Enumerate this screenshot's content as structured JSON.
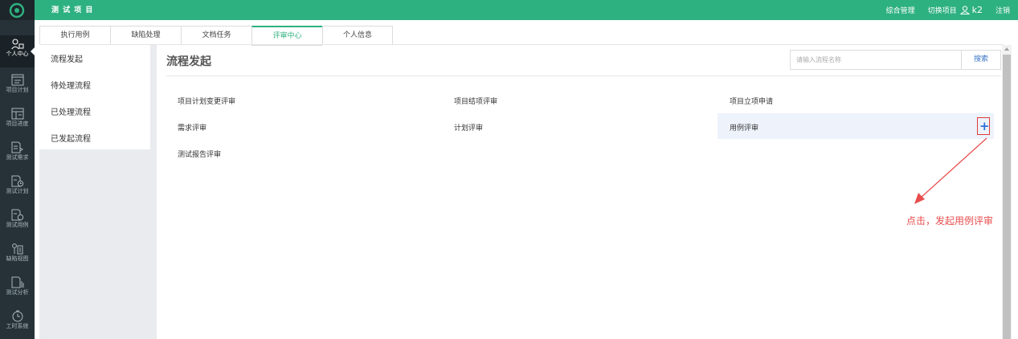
{
  "header": {
    "project_title": "测 试 项 目",
    "nav": {
      "admin": "综合管理",
      "switch_project": "切换项目",
      "username": "k2",
      "logout": "注销"
    }
  },
  "rail": {
    "items": [
      {
        "label": "个人中心",
        "icon": "person-center-icon"
      },
      {
        "label": "项目计划",
        "icon": "project-plan-icon"
      },
      {
        "label": "项目进度",
        "icon": "project-progress-icon"
      },
      {
        "label": "测试需求",
        "icon": "test-requirement-icon"
      },
      {
        "label": "测试计划",
        "icon": "test-plan-icon"
      },
      {
        "label": "测试用例",
        "icon": "test-case-icon"
      },
      {
        "label": "缺陷视图",
        "icon": "defect-view-icon"
      },
      {
        "label": "测试分析",
        "icon": "test-analysis-icon"
      },
      {
        "label": "工时系统",
        "icon": "timesheet-icon"
      }
    ]
  },
  "tabs": [
    {
      "label": "执行用例"
    },
    {
      "label": "缺陷处理"
    },
    {
      "label": "文档任务"
    },
    {
      "label": "评审中心"
    },
    {
      "label": "个人信息"
    }
  ],
  "submenu": [
    {
      "label": "流程发起"
    },
    {
      "label": "待处理流程"
    },
    {
      "label": "已处理流程"
    },
    {
      "label": "已发起流程"
    }
  ],
  "main": {
    "title": "流程发起",
    "search": {
      "placeholder": "请输入流程名称",
      "button": "搜索"
    },
    "flows": [
      "项目计划变更评审",
      "项目结项评审",
      "项目立项申请",
      "需求评审",
      "计划评审",
      "用例评审",
      "测试报告评审"
    ],
    "plus": "+",
    "annotation": "点击，发起用例评审"
  },
  "colors": {
    "brand": "#2eb180",
    "rail": "#263238",
    "annotation": "#e84d4d",
    "link": "#3a76c4"
  }
}
